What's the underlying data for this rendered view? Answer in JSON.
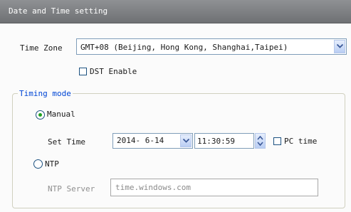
{
  "header": {
    "title": "Date and Time setting"
  },
  "time_zone": {
    "label": "Time Zone",
    "selected": "GMT+08 (Beijing, Hong Kong, Shanghai,Taipei)"
  },
  "dst": {
    "label": "DST Enable",
    "checked": false
  },
  "timing_mode": {
    "legend": "Timing mode",
    "manual": {
      "label": "Manual",
      "selected": true
    },
    "set_time": {
      "label": "Set Time",
      "date_value": "2014- 6-14",
      "time_value": "11:30:59",
      "pc_time_label": "PC time",
      "pc_time_checked": false
    },
    "ntp": {
      "label": "NTP",
      "selected": false,
      "server_label": "NTP Server",
      "server_value": "time.windows.com"
    }
  },
  "colors": {
    "header_bg": "#7f8184",
    "legend_text": "#0046d5",
    "radio_dot": "#21a121",
    "control_border": "#7f9db9"
  },
  "icons": {
    "dropdown": "chevron-down-icon",
    "spinner": "up-down-arrows-icon"
  }
}
